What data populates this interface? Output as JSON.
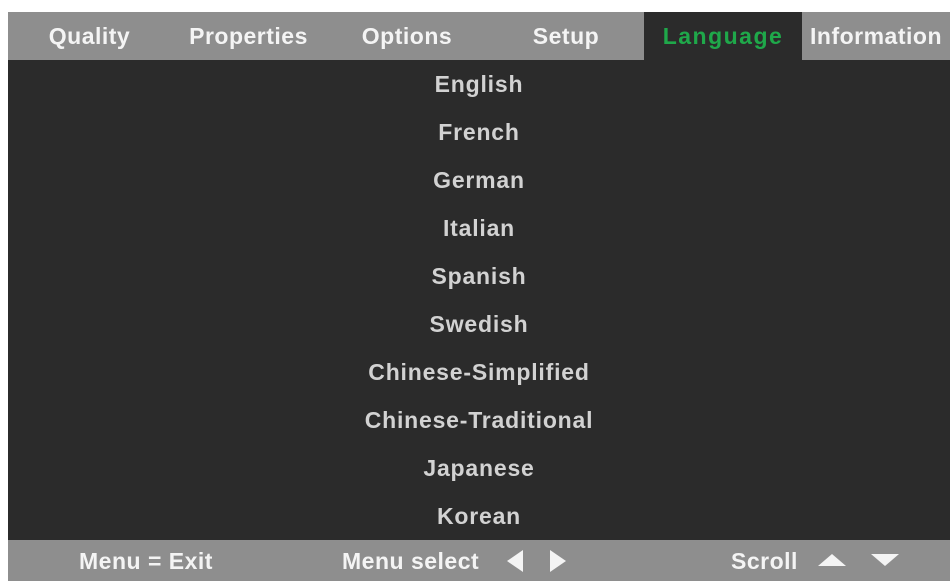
{
  "tabs": [
    {
      "label": "Quality"
    },
    {
      "label": "Properties"
    },
    {
      "label": "Options"
    },
    {
      "label": "Setup"
    },
    {
      "label": "Language",
      "active": true
    },
    {
      "label": "Information"
    }
  ],
  "languages": [
    "English",
    "French",
    "German",
    "Italian",
    "Spanish",
    "Swedish",
    "Chinese-Simplified",
    "Chinese-Traditional",
    "Japanese",
    "Korean"
  ],
  "footer": {
    "exit_hint": "Menu = Exit",
    "select_hint": "Menu select",
    "scroll_hint": "Scroll",
    "select_icons": [
      "arrow-left-icon",
      "arrow-right-icon"
    ],
    "scroll_icons": [
      "arrow-up-icon",
      "arrow-down-icon"
    ]
  },
  "colors": {
    "panel_background": "#2b2b2b",
    "bar_background": "#8e8e8e",
    "active_tab_text": "#1fa84a",
    "item_text": "#d2d2d2",
    "bar_text": "#f4f4f4"
  }
}
